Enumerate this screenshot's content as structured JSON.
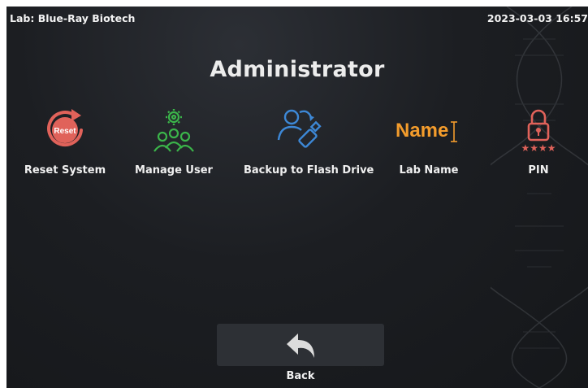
{
  "status_bar": {
    "lab_label": "Lab: Blue-Ray Biotech",
    "datetime": "2023-03-03 16:57"
  },
  "page": {
    "title": "Administrator"
  },
  "tiles": [
    {
      "label": "Reset System",
      "icon": "reset-icon",
      "icon_text": "Reset",
      "color": "#e0625a"
    },
    {
      "label": "Manage User",
      "icon": "users-gear-icon",
      "color": "#3bb54a"
    },
    {
      "label": "Backup to Flash Drive",
      "icon": "user-usb-backup-icon",
      "color": "#3d88d6"
    },
    {
      "label": "Lab Name",
      "icon": "name-text-icon",
      "icon_text": "Name",
      "color": "#f39c2c"
    },
    {
      "label": "PIN",
      "icon": "pin-lock-icon",
      "icon_text": "★★★★",
      "color": "#e0625a"
    }
  ],
  "footer": {
    "back_label": "Back",
    "back_icon": "back-arrow-icon"
  }
}
